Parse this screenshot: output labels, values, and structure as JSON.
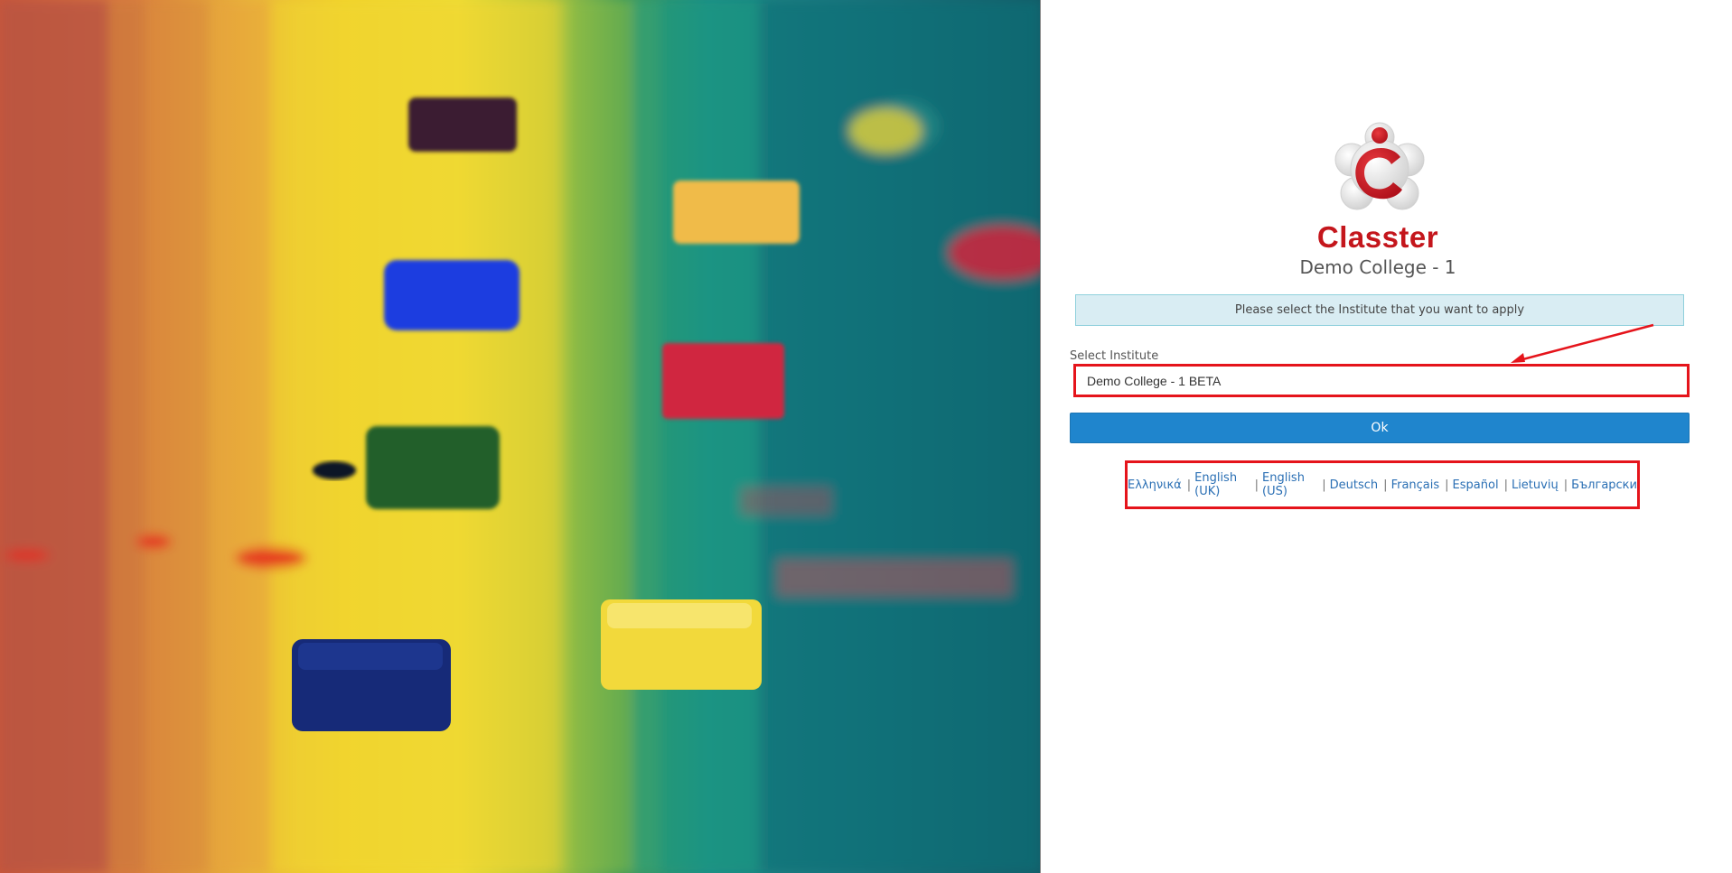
{
  "brand": {
    "name": "Classter",
    "college": "Demo College - 1"
  },
  "notice": {
    "text": "Please select the Institute that you want to apply"
  },
  "institute_select": {
    "label": "Select Institute",
    "selected": "Demo College - 1 BETA"
  },
  "actions": {
    "ok_label": "Ok"
  },
  "languages": [
    {
      "label": "Ελληνικά"
    },
    {
      "label": "English (UK)"
    },
    {
      "label": "English (US)"
    },
    {
      "label": "Deutsch"
    },
    {
      "label": "Français"
    },
    {
      "label": "Español"
    },
    {
      "label": "Lietuvių"
    },
    {
      "label": "Български"
    }
  ],
  "colors": {
    "brand_red": "#c4161c",
    "button_blue": "#1f85cd",
    "notice_bg": "#d9edf3",
    "annotation_red": "#e5141b"
  }
}
